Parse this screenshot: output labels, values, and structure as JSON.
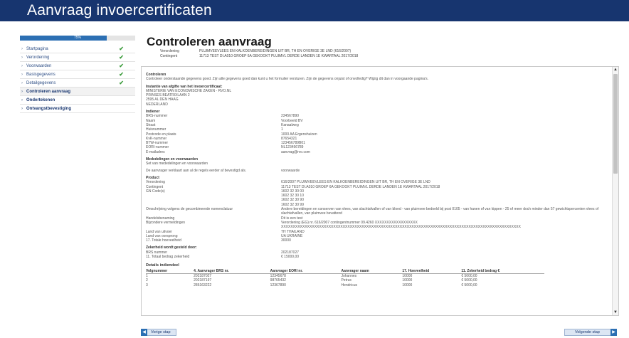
{
  "app": {
    "title": "Aanvraag invoercertificaten"
  },
  "progress": {
    "label": "75%",
    "value": 0.75
  },
  "sidebar": {
    "items": [
      {
        "label": "Startpagina",
        "done": true
      },
      {
        "label": "Verordening",
        "done": true
      },
      {
        "label": "Voorwaarden",
        "done": true
      },
      {
        "label": "Basisgegevens",
        "done": true
      },
      {
        "label": "Detailgegevens",
        "done": true
      },
      {
        "label": "Controleren aanvraag",
        "done": false,
        "active": true
      },
      {
        "label": "Ondertekenen",
        "done": false
      },
      {
        "label": "Ontvangstbevestiging",
        "done": false
      }
    ],
    "check_glyph": "✔",
    "bullet_glyph": "›"
  },
  "page": {
    "title": "Controleren aanvraag",
    "meta": [
      {
        "label": "Verordening",
        "value": "PLUIMVEEVLEES EN KALKOENBEREIDINGEN UIT BR, TH EN OVERIGE 3E LND (616/2007)"
      },
      {
        "label": "Contingent",
        "value": "11713 TEST DI.A010 GROEP 6A GEKOOKT PLUIMVL DERDE LANDEN 1E KWARTAAL 2017/2018"
      }
    ]
  },
  "content": {
    "controleren": {
      "heading": "Controleren",
      "text": "Controleer onderstaande gegevens goed. Zijn alle gegevens goed dan kunt u het formulier versturen. Zijn de gegevens onjuist of onvolledig? Wijzig dit dan in voorgaande pagina's."
    },
    "instantie": {
      "heading": "Instantie van afgifte van het invoercertificaat:",
      "lines": [
        "MINISTERIE VAN ECONOMISCHE ZAKEN - RVO.NL",
        "PRINSES BEATRIXLAAN 2",
        "2595 AL DEN HAAG",
        "NEDERLAND"
      ]
    },
    "indiener": {
      "heading": "Indiener",
      "rows": [
        {
          "k": "BRS-nummer",
          "v": "234567890"
        },
        {
          "k": "Naam",
          "v": "Voorbeeld BV"
        },
        {
          "k": "Straat",
          "v": "Kanaalweg"
        },
        {
          "k": "Huisnummer",
          "v": "1"
        },
        {
          "k": "Postcode en plaats",
          "v": "1000 AA Ergenshuizen"
        },
        {
          "k": "KvK-nummer",
          "v": "87654321"
        },
        {
          "k": "BTW-nummer",
          "v": "123456789B01"
        },
        {
          "k": "EORI-nummer",
          "v": "NL123456789"
        },
        {
          "k": "E-mailadres",
          "v": "aanvrag@rvo.com"
        }
      ]
    },
    "mededelingen": {
      "heading": "Mededelingen en voorwaarden",
      "line1": "Set van mededelingen en voorwaarden",
      "k": "De aanvrager verklaart aan al de regels eerder af bevestigd als.",
      "v": "voorwaarde"
    },
    "product": {
      "heading": "Product",
      "rows": [
        {
          "k": "Verordening",
          "v": "616/2007 PLUIMVEEVLEES EN KALKOENBEREIDINGEN UIT BR, TH EN OVERIGE 3E LND"
        },
        {
          "k": "Contingent",
          "v": "11713 TEST DI.A010 GROEP 6A GEKOOKT PLUIMVL DERDE LANDEN 1E KWARTAAL 2017/2018"
        },
        {
          "k": "GN Code(s)",
          "v": "1602 32 30 00"
        },
        {
          "k": "",
          "v": "1602 32 30 10"
        },
        {
          "k": "",
          "v": "1602 32 30 90"
        },
        {
          "k": "",
          "v": "1602 32 30 99"
        },
        {
          "k": "Omschrijving volgens de gecombineerde nomenclatuur",
          "v": "Andere bereidingen en conserven van vlees, van slachtafvallen of van bloed - van pluimvee bedoeld bij post 0105 - van hanen of van kippen - 25 of meer doch minder dan 57 gewichtspercenten vlees of slachtafvallen, van pluimvee bevattend"
        },
        {
          "k": "Handelsbenaming",
          "v": "Dit is een test"
        },
        {
          "k": "Bijzondere vermeldingen",
          "v": "Verordening (EG) nr. 616/2007 contingentnummer 09.4260 XXXXXXXXXXXXXXXXXX"
        },
        {
          "k": "",
          "v": "XXXXXXXXXXXXXXXXXXXXXXXXXXXXXXXXXXXXXXXXXXXXXXXXXXXXXXXXXXXXXXXXXXXXXXXXXXXXXXXXXXXXXXXXXXXXXXXXXXXXX"
        },
        {
          "k": "Land van uitvoer",
          "v": "TH THAILAND"
        },
        {
          "k": "Land van oorsprong",
          "v": "UA UKRAINE"
        },
        {
          "k": "17. Totale hoeveelheid",
          "v": "30000"
        }
      ]
    },
    "zekerheid": {
      "heading": "Zekerheid wordt gesteld door:",
      "rows": [
        {
          "k": "BRS nummer",
          "v": "202187027"
        },
        {
          "k": "11. Totaal bedrag zekerheid",
          "v": "€ 15000,00"
        }
      ]
    },
    "details": {
      "title": "Details indiendeel",
      "columns": [
        "Volgnummer",
        "4. Aanvrager BRS nr.",
        "Aanvrager EORI nr.",
        "Aanvrager naam",
        "17. Hoeveelheid",
        "11. Zekerheid bedrag €"
      ],
      "rows": [
        [
          "1",
          "202187027",
          "12345678",
          "Johannes",
          "10000",
          "€ 5000,00"
        ],
        [
          "2",
          "202187197",
          "98765432",
          "Petrus",
          "10000",
          "€ 5000,00"
        ],
        [
          "3",
          "286163222",
          "12367890",
          "Hendricus",
          "10000",
          "€ 5000,00"
        ]
      ]
    }
  },
  "buttons": {
    "prev": "Vorige stap",
    "next": "Volgende stap"
  },
  "icons": {
    "prev": "arrow-left-icon",
    "next": "arrow-right-icon",
    "scroll_up": "▲",
    "scroll_down": "▼"
  },
  "colors": {
    "banner": "#17356f",
    "accent": "#2c6fb3",
    "check": "#3a9b3a"
  }
}
